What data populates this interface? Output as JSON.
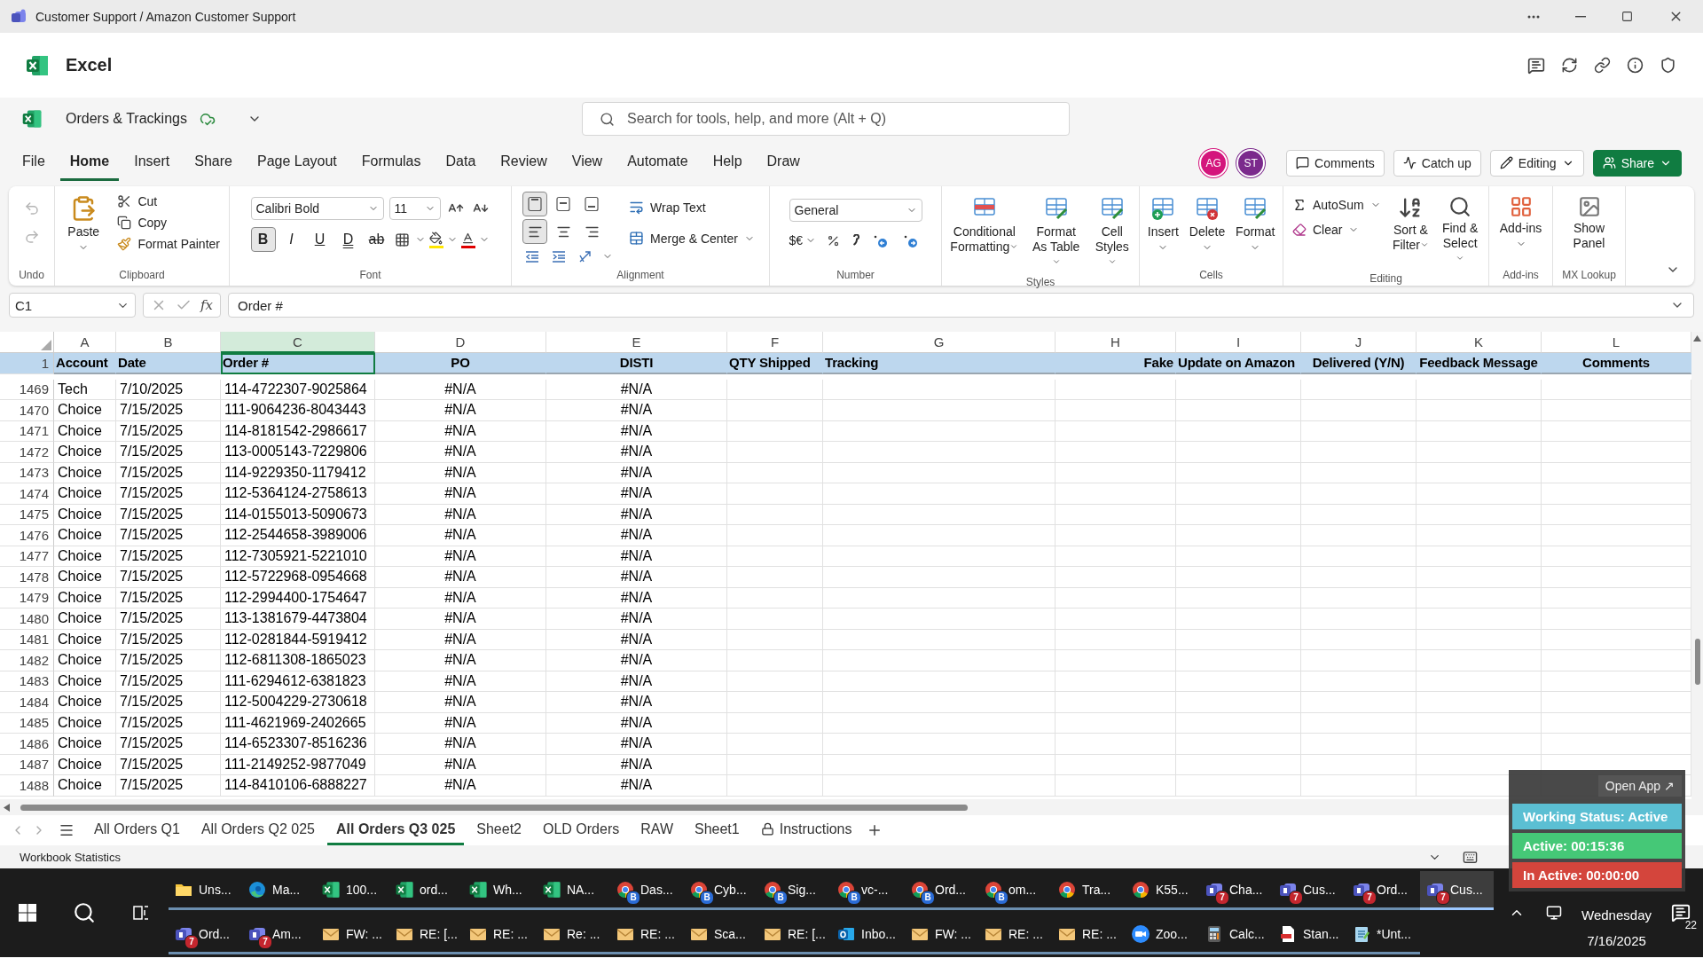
{
  "window": {
    "title": "Customer Support / Amazon Customer Support"
  },
  "app": {
    "name": "Excel"
  },
  "document": {
    "name": "Orders & Trackings",
    "saved": true
  },
  "search": {
    "placeholder": "Search for tools, help, and more (Alt + Q)"
  },
  "menu_tabs": [
    {
      "label": "File",
      "selected": false
    },
    {
      "label": "Home",
      "selected": true
    },
    {
      "label": "Insert",
      "selected": false
    },
    {
      "label": "Share",
      "selected": false
    },
    {
      "label": "Page Layout",
      "selected": false
    },
    {
      "label": "Formulas",
      "selected": false
    },
    {
      "label": "Data",
      "selected": false
    },
    {
      "label": "Review",
      "selected": false
    },
    {
      "label": "View",
      "selected": false
    },
    {
      "label": "Automate",
      "selected": false
    },
    {
      "label": "Help",
      "selected": false
    },
    {
      "label": "Draw",
      "selected": false
    }
  ],
  "collaborators": [
    {
      "initials": "AG",
      "color": "#d4157c"
    },
    {
      "initials": "ST",
      "color": "#7b2a8c"
    }
  ],
  "actions": [
    {
      "label": "Comments",
      "kind": "comments"
    },
    {
      "label": "Catch up",
      "kind": "catchup"
    },
    {
      "label": "Editing",
      "kind": "mode"
    },
    {
      "label": "Share",
      "kind": "share"
    }
  ],
  "ribbon": [
    {
      "kind": "undo",
      "label": "Undo",
      "buttons": [
        {
          "disabled": true
        },
        {
          "disabled": true
        }
      ]
    },
    {
      "kind": "clipboard",
      "label": "Clipboard",
      "paste": "Paste",
      "items": [
        "Cut",
        "Copy",
        "Format Painter"
      ]
    },
    {
      "kind": "font",
      "label": "Font",
      "font": "Calibri Bold",
      "size": "11",
      "styles": [
        {
          "label": "B",
          "selected": true
        },
        {
          "label": "I",
          "selected": false
        },
        {
          "label": "U",
          "selected": false
        },
        {
          "label": "D",
          "selected": false
        },
        {
          "label": "ab",
          "selected": false
        }
      ]
    },
    {
      "kind": "alignment",
      "label": "Alignment",
      "vertical": [
        {
          "selected": true
        },
        {
          "selected": false
        },
        {
          "selected": false
        }
      ],
      "horizontal": [
        {
          "selected": true
        },
        {
          "selected": false
        },
        {
          "selected": false
        }
      ],
      "items": [
        "Wrap Text",
        "Merge & Center"
      ]
    },
    {
      "kind": "number",
      "label": "Number",
      "format": "General",
      "currency": "$€"
    },
    {
      "kind": "styles",
      "label": "Styles",
      "items": [
        "Conditional Formatting",
        "Format As Table",
        "Cell Styles"
      ]
    },
    {
      "kind": "cells",
      "label": "Cells",
      "items": [
        "Insert",
        "Delete",
        "Format"
      ]
    },
    {
      "kind": "editing",
      "label": "Editing",
      "small": [
        "AutoSum",
        "Clear"
      ],
      "large": [
        "Sort & Filter",
        "Find & Select"
      ]
    },
    {
      "kind": "addins",
      "label": "Add-ins",
      "items": [
        "Add-ins"
      ]
    },
    {
      "kind": "lookup",
      "label": "MX Lookup",
      "items": [
        "Show Panel"
      ]
    }
  ],
  "formula_bar": {
    "name_box": "C1",
    "function_symbol": "fx",
    "formula": "Order #"
  },
  "grid": {
    "columns": [
      {
        "letter": "A",
        "selected": false
      },
      {
        "letter": "B",
        "selected": false
      },
      {
        "letter": "C",
        "selected": true
      },
      {
        "letter": "D",
        "selected": false
      },
      {
        "letter": "E",
        "selected": false
      },
      {
        "letter": "F",
        "selected": false
      },
      {
        "letter": "G",
        "selected": false
      },
      {
        "letter": "H",
        "selected": false
      },
      {
        "letter": "I",
        "selected": false
      },
      {
        "letter": "J",
        "selected": false
      },
      {
        "letter": "K",
        "selected": false
      },
      {
        "letter": "L",
        "selected": false
      }
    ],
    "header_row": {
      "number": "1",
      "cells": [
        {
          "text": "Account",
          "selected": false
        },
        {
          "text": "Date",
          "selected": false
        },
        {
          "text": "Order #",
          "selected": true
        },
        {
          "text": "PO",
          "selected": false
        },
        {
          "text": "DISTI",
          "selected": false
        },
        {
          "text": "QTY Shipped",
          "selected": false
        },
        {
          "text": "Tracking",
          "selected": false
        },
        {
          "text": "Fake",
          "selected": false
        },
        {
          "text": "Update on Amazon",
          "selected": false
        },
        {
          "text": "Delivered (Y/N)",
          "selected": false
        },
        {
          "text": "Feedback Message",
          "selected": false
        },
        {
          "text": "Comments",
          "selected": false
        }
      ]
    },
    "rows": [
      {
        "number": "1469",
        "cells": [
          "Tech",
          "7/10/2025",
          "114-4722307-9025864",
          "#N/A",
          "#N/A"
        ]
      },
      {
        "number": "1470",
        "cells": [
          "Choice",
          "7/15/2025",
          "111-9064236-8043443",
          "#N/A",
          "#N/A"
        ]
      },
      {
        "number": "1471",
        "cells": [
          "Choice",
          "7/15/2025",
          "114-8181542-2986617",
          "#N/A",
          "#N/A"
        ]
      },
      {
        "number": "1472",
        "cells": [
          "Choice",
          "7/15/2025",
          "113-0005143-7229806",
          "#N/A",
          "#N/A"
        ]
      },
      {
        "number": "1473",
        "cells": [
          "Choice",
          "7/15/2025",
          "114-9229350-1179412",
          "#N/A",
          "#N/A"
        ]
      },
      {
        "number": "1474",
        "cells": [
          "Choice",
          "7/15/2025",
          "112-5364124-2758613",
          "#N/A",
          "#N/A"
        ]
      },
      {
        "number": "1475",
        "cells": [
          "Choice",
          "7/15/2025",
          "114-0155013-5090673",
          "#N/A",
          "#N/A"
        ]
      },
      {
        "number": "1476",
        "cells": [
          "Choice",
          "7/15/2025",
          "112-2544658-3989006",
          "#N/A",
          "#N/A"
        ]
      },
      {
        "number": "1477",
        "cells": [
          "Choice",
          "7/15/2025",
          "112-7305921-5221010",
          "#N/A",
          "#N/A"
        ]
      },
      {
        "number": "1478",
        "cells": [
          "Choice",
          "7/15/2025",
          "112-5722968-0954668",
          "#N/A",
          "#N/A"
        ]
      },
      {
        "number": "1479",
        "cells": [
          "Choice",
          "7/15/2025",
          "112-2994400-1754647",
          "#N/A",
          "#N/A"
        ]
      },
      {
        "number": "1480",
        "cells": [
          "Choice",
          "7/15/2025",
          "113-1381679-4473804",
          "#N/A",
          "#N/A"
        ]
      },
      {
        "number": "1481",
        "cells": [
          "Choice",
          "7/15/2025",
          "112-0281844-5919412",
          "#N/A",
          "#N/A"
        ]
      },
      {
        "number": "1482",
        "cells": [
          "Choice",
          "7/15/2025",
          "112-6811308-1865023",
          "#N/A",
          "#N/A"
        ]
      },
      {
        "number": "1483",
        "cells": [
          "Choice",
          "7/15/2025",
          "111-6294612-6381823",
          "#N/A",
          "#N/A"
        ]
      },
      {
        "number": "1484",
        "cells": [
          "Choice",
          "7/15/2025",
          "112-5004229-2730618",
          "#N/A",
          "#N/A"
        ]
      },
      {
        "number": "1485",
        "cells": [
          "Choice",
          "7/15/2025",
          "111-4621969-2402665",
          "#N/A",
          "#N/A"
        ]
      },
      {
        "number": "1486",
        "cells": [
          "Choice",
          "7/15/2025",
          "114-6523307-8516236",
          "#N/A",
          "#N/A"
        ]
      },
      {
        "number": "1487",
        "cells": [
          "Choice",
          "7/15/2025",
          "111-2149252-9877049",
          "#N/A",
          "#N/A"
        ]
      },
      {
        "number": "1488",
        "cells": [
          "Choice",
          "7/15/2025",
          "114-8410106-6888227",
          "#N/A",
          "#N/A"
        ]
      }
    ]
  },
  "sheet_tabs": [
    {
      "label": "All Orders Q1",
      "selected": false,
      "locked": false
    },
    {
      "label": "All Orders Q2 025",
      "selected": false,
      "locked": false
    },
    {
      "label": "All Orders Q3 025",
      "selected": true,
      "locked": false
    },
    {
      "label": "Sheet2",
      "selected": false,
      "locked": false
    },
    {
      "label": "OLD Orders",
      "selected": false,
      "locked": false
    },
    {
      "label": "RAW",
      "selected": false,
      "locked": false
    },
    {
      "label": "Sheet1",
      "selected": false,
      "locked": false
    },
    {
      "label": "Instructions",
      "selected": false,
      "locked": true
    }
  ],
  "status_bar": {
    "text": "Workbook Statistics"
  },
  "tracker": {
    "link": "Open App ↗",
    "status": "Working Status: Active",
    "active": "Active: 00:15:36",
    "inactive": "In Active: 00:00:00"
  },
  "taskbar": {
    "rows": [
      [
        {
          "label": "Uns...",
          "kind": "folder",
          "selected": false
        },
        {
          "label": "Ma...",
          "kind": "edge",
          "selected": false
        },
        {
          "label": "100...",
          "kind": "excel",
          "selected": false
        },
        {
          "label": "ord...",
          "kind": "excel",
          "selected": false
        },
        {
          "label": "Wh...",
          "kind": "excel",
          "selected": false
        },
        {
          "label": "NA...",
          "kind": "excel",
          "selected": false
        },
        {
          "label": "Das...",
          "kind": "chrome",
          "badge": "B",
          "selected": false
        },
        {
          "label": "Cyb...",
          "kind": "chrome",
          "badge": "B",
          "selected": false
        },
        {
          "label": "Sig...",
          "kind": "chrome",
          "badge": "B",
          "selected": false
        },
        {
          "label": "vc-...",
          "kind": "chrome",
          "badge": "B",
          "selected": false
        },
        {
          "label": "Ord...",
          "kind": "chrome",
          "badge": "B",
          "selected": false
        },
        {
          "label": "om...",
          "kind": "chrome",
          "badge": "B",
          "selected": false
        },
        {
          "label": "Tra...",
          "kind": "chrome",
          "selected": false
        },
        {
          "label": "K55...",
          "kind": "chrome",
          "selected": false
        },
        {
          "label": "Cha...",
          "kind": "teams",
          "badge": "7",
          "selected": false
        },
        {
          "label": "Cus...",
          "kind": "teams",
          "badge": "7",
          "selected": false
        },
        {
          "label": "Ord...",
          "kind": "teams",
          "badge": "7",
          "selected": false
        },
        {
          "label": "Cus...",
          "kind": "teams",
          "badge": "7",
          "selected": true
        }
      ],
      [
        {
          "label": "Ord...",
          "kind": "teams",
          "badge": "7",
          "selected": false
        },
        {
          "label": "Am...",
          "kind": "teams",
          "badge": "7",
          "selected": false
        },
        {
          "label": "FW: ...",
          "kind": "mail",
          "selected": false
        },
        {
          "label": "RE: [...",
          "kind": "mail",
          "selected": false
        },
        {
          "label": "RE: ...",
          "kind": "mail",
          "selected": false
        },
        {
          "label": "Re: ...",
          "kind": "mail",
          "selected": false
        },
        {
          "label": "RE: ...",
          "kind": "mail",
          "selected": false
        },
        {
          "label": "Sca...",
          "kind": "mail",
          "selected": false
        },
        {
          "label": "RE: [...",
          "kind": "mail",
          "selected": false
        },
        {
          "label": "Inbo...",
          "kind": "outlook",
          "selected": false
        },
        {
          "label": "FW: ...",
          "kind": "mail",
          "selected": false
        },
        {
          "label": "RE: ...",
          "kind": "mail",
          "selected": false
        },
        {
          "label": "RE: ...",
          "kind": "mail",
          "selected": false
        },
        {
          "label": "Zoo...",
          "kind": "zoom",
          "selected": false
        },
        {
          "label": "Calc...",
          "kind": "calculator",
          "selected": false
        },
        {
          "label": "Stan...",
          "kind": "pdf",
          "selected": false
        },
        {
          "label": "*Unt...",
          "kind": "notepad",
          "selected": false
        }
      ]
    ],
    "day": "Wednesday",
    "date": "7/16/2025",
    "notifications": "22"
  }
}
